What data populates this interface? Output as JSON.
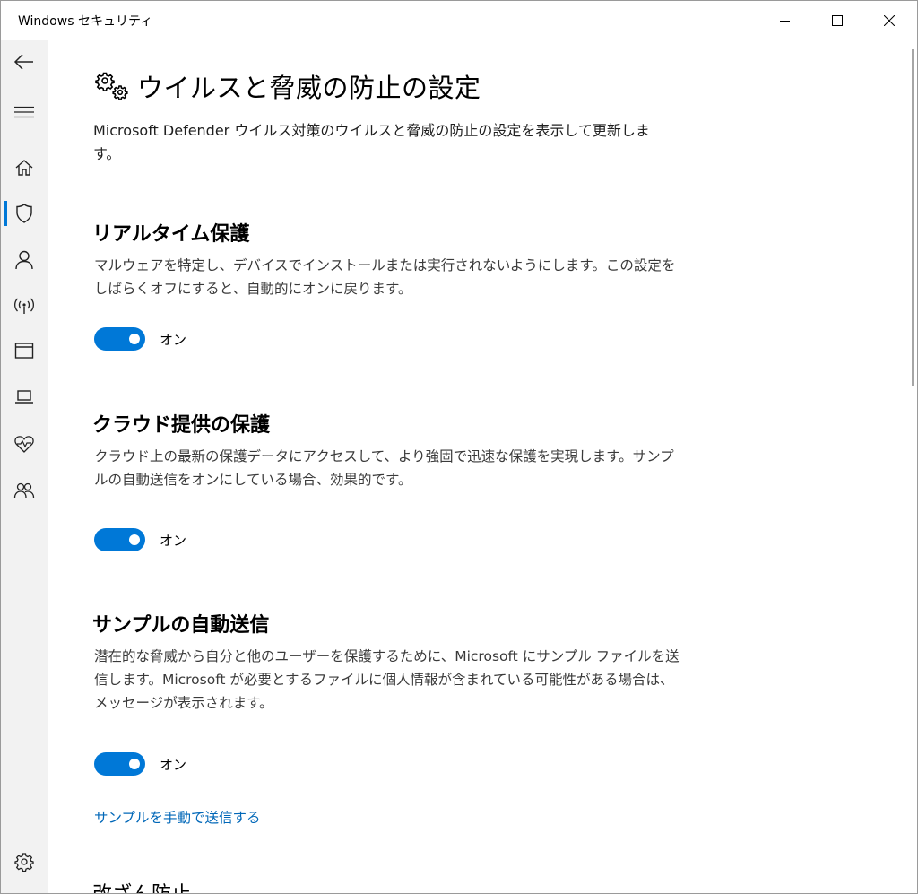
{
  "window": {
    "title": "Windows セキュリティ"
  },
  "sidebar": {
    "items": [
      {
        "icon": "back-arrow-icon"
      },
      {
        "icon": "hamburger-menu-icon"
      },
      {
        "icon": "home-icon"
      },
      {
        "icon": "shield-icon",
        "active": true
      },
      {
        "icon": "person-icon"
      },
      {
        "icon": "wireless-icon"
      },
      {
        "icon": "app-browser-icon"
      },
      {
        "icon": "laptop-icon"
      },
      {
        "icon": "heart-pulse-icon"
      },
      {
        "icon": "family-icon"
      },
      {
        "icon": "gear-icon"
      }
    ]
  },
  "page": {
    "title": "ウイルスと脅威の防止の設定",
    "description": "Microsoft Defender ウイルス対策のウイルスと脅威の防止の設定を表示して更新します。"
  },
  "sections": [
    {
      "title": "リアルタイム保護",
      "description": "マルウェアを特定し、デバイスでインストールまたは実行されないようにします。この設定をしばらくオフにすると、自動的にオンに戻ります。",
      "toggle_state": "オン"
    },
    {
      "title": "クラウド提供の保護",
      "description": "クラウド上の最新の保護データにアクセスして、より強固で迅速な保護を実現します。サンプルの自動送信をオンにしている場合、効果的です。",
      "toggle_state": "オン"
    },
    {
      "title": "サンプルの自動送信",
      "description": "潜在的な脅威から自分と他のユーザーを保護するために、Microsoft にサンプル ファイルを送信します。Microsoft が必要とするファイルに個人情報が含まれている可能性がある場合は、メッセージが表示されます。",
      "toggle_state": "オン",
      "link": "サンプルを手動で送信する"
    }
  ],
  "next_section_title": "改ざん防止",
  "colors": {
    "accent": "#0078d7",
    "link": "#0067b8",
    "sidebar_bg": "#f2f2f2"
  }
}
